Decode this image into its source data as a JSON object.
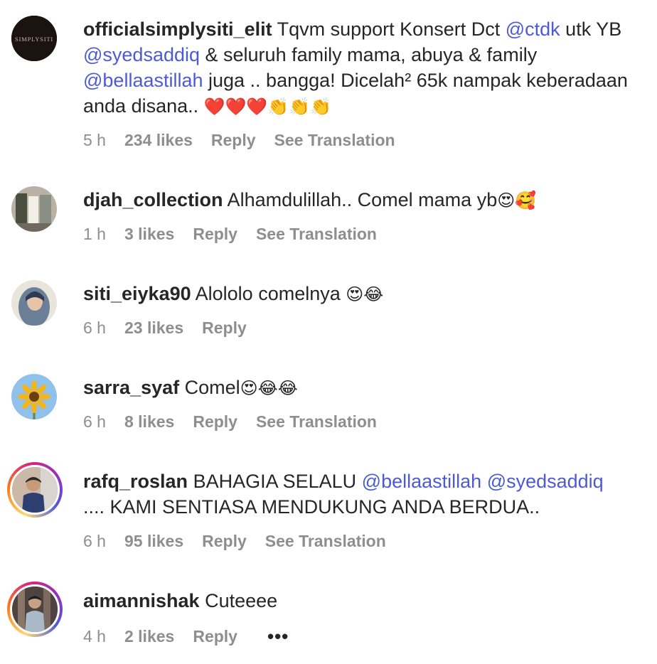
{
  "comments": [
    {
      "username": "officialsimplysiti_elit",
      "text_1": " Tqvm support Konsert Dct ",
      "mention_1": "@ctdk",
      "text_2": " utk YB ",
      "mention_2": "@syedsaddiq",
      "text_3": " & seluruh family mama, abuya & family ",
      "mention_3": "@bellaastillah",
      "text_4": " juga .. bangga! Dicelah² 65k nampak keberadaan anda disana.. ",
      "emojis": "❤️❤️❤️👏👏👏",
      "avatar_text": "SIMPLYSITI",
      "time": "5 h",
      "likes": "234 likes",
      "reply": "Reply",
      "translate": "See Translation"
    },
    {
      "username": "djah_collection",
      "text": " Alhamdulillah.. Comel mama yb",
      "emojis": "😍🥰",
      "time": "1 h",
      "likes": "3 likes",
      "reply": "Reply",
      "translate": "See Translation"
    },
    {
      "username": "siti_eiyka90",
      "text": " Alololo comelnya ",
      "emojis": "😍😂",
      "time": "6 h",
      "likes": "23 likes",
      "reply": "Reply"
    },
    {
      "username": "sarra_syaf",
      "text": " Comel",
      "emojis": "😍😂😂",
      "time": "6 h",
      "likes": "8 likes",
      "reply": "Reply",
      "translate": "See Translation"
    },
    {
      "username": "rafq_roslan",
      "text_1": " BAHAGIA SELALU ",
      "mention_1": "@bellaastillah",
      "mention_2": "@syedsaddiq",
      "text_2": ".... KAMI SENTIASA MENDUKUNG ANDA BERDUA..",
      "time": "6 h",
      "likes": "95 likes",
      "reply": "Reply",
      "translate": "See Translation"
    },
    {
      "username": "aimannishak",
      "text": " Cuteeee",
      "time": "4 h",
      "likes": "2 likes",
      "reply": "Reply",
      "more": "•••"
    }
  ],
  "colors": {
    "mention": "#4c5bd4",
    "meta": "#8e8e8e",
    "text": "#262626"
  }
}
